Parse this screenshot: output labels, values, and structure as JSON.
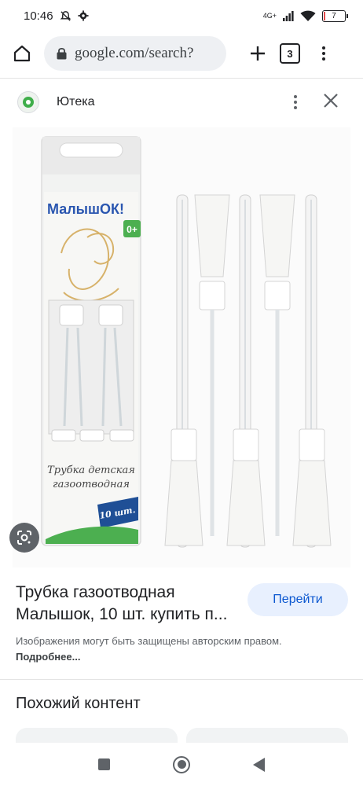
{
  "status": {
    "time": "10:46",
    "network": "4G+",
    "battery": "7"
  },
  "browser": {
    "url": "google.com/search?",
    "tab_count": "3"
  },
  "source": {
    "name": "Ютека"
  },
  "product": {
    "brand": "МалышОК!",
    "age": "0+",
    "name_line1": "Трубка детская",
    "name_line2": "газоотводная",
    "count": "10 шт."
  },
  "result": {
    "title_line1": "Трубка газоотводная",
    "title_line2": "Малышок, 10 шт. купить п...",
    "visit_label": "Перейти",
    "copyright_text": "Изображения могут быть защищены авторским правом.",
    "more_link": "Подробнее..."
  },
  "similar": {
    "heading": "Похожий контент"
  }
}
